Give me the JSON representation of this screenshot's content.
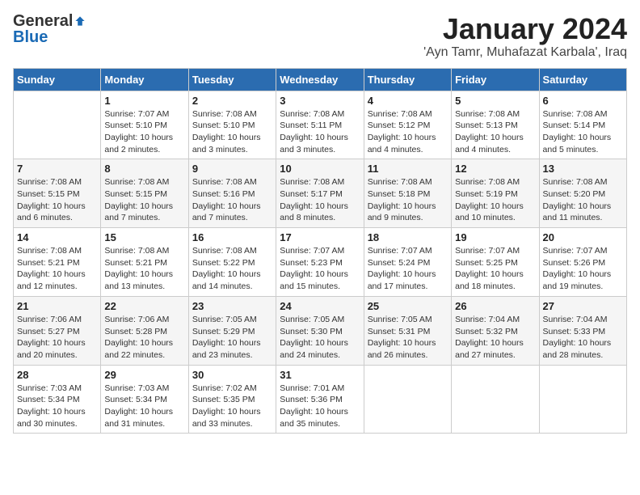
{
  "header": {
    "logo_general": "General",
    "logo_blue": "Blue",
    "month_title": "January 2024",
    "location": "'Ayn Tamr, Muhafazat Karbala', Iraq"
  },
  "days_of_week": [
    "Sunday",
    "Monday",
    "Tuesday",
    "Wednesday",
    "Thursday",
    "Friday",
    "Saturday"
  ],
  "weeks": [
    [
      {
        "day": "",
        "info": ""
      },
      {
        "day": "1",
        "info": "Sunrise: 7:07 AM\nSunset: 5:10 PM\nDaylight: 10 hours\nand 2 minutes."
      },
      {
        "day": "2",
        "info": "Sunrise: 7:08 AM\nSunset: 5:10 PM\nDaylight: 10 hours\nand 3 minutes."
      },
      {
        "day": "3",
        "info": "Sunrise: 7:08 AM\nSunset: 5:11 PM\nDaylight: 10 hours\nand 3 minutes."
      },
      {
        "day": "4",
        "info": "Sunrise: 7:08 AM\nSunset: 5:12 PM\nDaylight: 10 hours\nand 4 minutes."
      },
      {
        "day": "5",
        "info": "Sunrise: 7:08 AM\nSunset: 5:13 PM\nDaylight: 10 hours\nand 4 minutes."
      },
      {
        "day": "6",
        "info": "Sunrise: 7:08 AM\nSunset: 5:14 PM\nDaylight: 10 hours\nand 5 minutes."
      }
    ],
    [
      {
        "day": "7",
        "info": "Sunrise: 7:08 AM\nSunset: 5:15 PM\nDaylight: 10 hours\nand 6 minutes."
      },
      {
        "day": "8",
        "info": "Sunrise: 7:08 AM\nSunset: 5:15 PM\nDaylight: 10 hours\nand 7 minutes."
      },
      {
        "day": "9",
        "info": "Sunrise: 7:08 AM\nSunset: 5:16 PM\nDaylight: 10 hours\nand 7 minutes."
      },
      {
        "day": "10",
        "info": "Sunrise: 7:08 AM\nSunset: 5:17 PM\nDaylight: 10 hours\nand 8 minutes."
      },
      {
        "day": "11",
        "info": "Sunrise: 7:08 AM\nSunset: 5:18 PM\nDaylight: 10 hours\nand 9 minutes."
      },
      {
        "day": "12",
        "info": "Sunrise: 7:08 AM\nSunset: 5:19 PM\nDaylight: 10 hours\nand 10 minutes."
      },
      {
        "day": "13",
        "info": "Sunrise: 7:08 AM\nSunset: 5:20 PM\nDaylight: 10 hours\nand 11 minutes."
      }
    ],
    [
      {
        "day": "14",
        "info": "Sunrise: 7:08 AM\nSunset: 5:21 PM\nDaylight: 10 hours\nand 12 minutes."
      },
      {
        "day": "15",
        "info": "Sunrise: 7:08 AM\nSunset: 5:21 PM\nDaylight: 10 hours\nand 13 minutes."
      },
      {
        "day": "16",
        "info": "Sunrise: 7:08 AM\nSunset: 5:22 PM\nDaylight: 10 hours\nand 14 minutes."
      },
      {
        "day": "17",
        "info": "Sunrise: 7:07 AM\nSunset: 5:23 PM\nDaylight: 10 hours\nand 15 minutes."
      },
      {
        "day": "18",
        "info": "Sunrise: 7:07 AM\nSunset: 5:24 PM\nDaylight: 10 hours\nand 17 minutes."
      },
      {
        "day": "19",
        "info": "Sunrise: 7:07 AM\nSunset: 5:25 PM\nDaylight: 10 hours\nand 18 minutes."
      },
      {
        "day": "20",
        "info": "Sunrise: 7:07 AM\nSunset: 5:26 PM\nDaylight: 10 hours\nand 19 minutes."
      }
    ],
    [
      {
        "day": "21",
        "info": "Sunrise: 7:06 AM\nSunset: 5:27 PM\nDaylight: 10 hours\nand 20 minutes."
      },
      {
        "day": "22",
        "info": "Sunrise: 7:06 AM\nSunset: 5:28 PM\nDaylight: 10 hours\nand 22 minutes."
      },
      {
        "day": "23",
        "info": "Sunrise: 7:05 AM\nSunset: 5:29 PM\nDaylight: 10 hours\nand 23 minutes."
      },
      {
        "day": "24",
        "info": "Sunrise: 7:05 AM\nSunset: 5:30 PM\nDaylight: 10 hours\nand 24 minutes."
      },
      {
        "day": "25",
        "info": "Sunrise: 7:05 AM\nSunset: 5:31 PM\nDaylight: 10 hours\nand 26 minutes."
      },
      {
        "day": "26",
        "info": "Sunrise: 7:04 AM\nSunset: 5:32 PM\nDaylight: 10 hours\nand 27 minutes."
      },
      {
        "day": "27",
        "info": "Sunrise: 7:04 AM\nSunset: 5:33 PM\nDaylight: 10 hours\nand 28 minutes."
      }
    ],
    [
      {
        "day": "28",
        "info": "Sunrise: 7:03 AM\nSunset: 5:34 PM\nDaylight: 10 hours\nand 30 minutes."
      },
      {
        "day": "29",
        "info": "Sunrise: 7:03 AM\nSunset: 5:34 PM\nDaylight: 10 hours\nand 31 minutes."
      },
      {
        "day": "30",
        "info": "Sunrise: 7:02 AM\nSunset: 5:35 PM\nDaylight: 10 hours\nand 33 minutes."
      },
      {
        "day": "31",
        "info": "Sunrise: 7:01 AM\nSunset: 5:36 PM\nDaylight: 10 hours\nand 35 minutes."
      },
      {
        "day": "",
        "info": ""
      },
      {
        "day": "",
        "info": ""
      },
      {
        "day": "",
        "info": ""
      }
    ]
  ]
}
